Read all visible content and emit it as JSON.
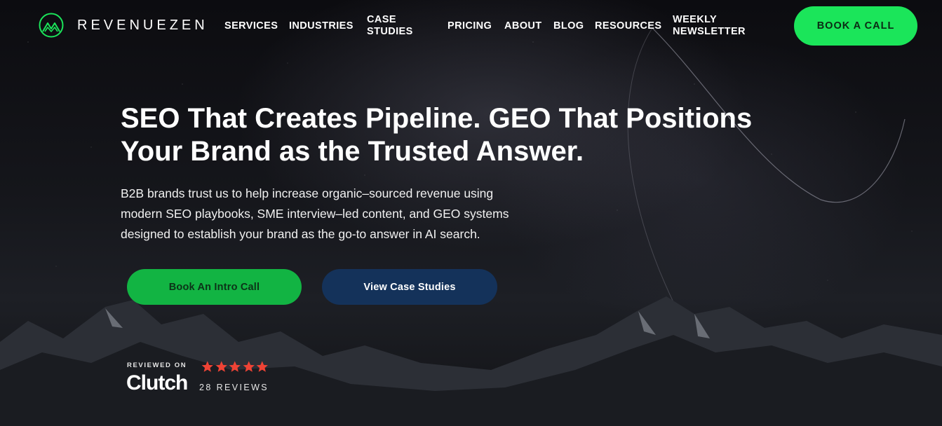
{
  "brand": {
    "name": "REVENUEZEN",
    "logo_icon": "mountain-logo-icon",
    "accent": "#1be55a"
  },
  "nav": [
    {
      "label": "SERVICES"
    },
    {
      "label": "INDUSTRIES"
    },
    {
      "label_line1": "CASE",
      "label_line2": "STUDIES"
    },
    {
      "label": "PRICING"
    },
    {
      "label": "ABOUT"
    },
    {
      "label": "BLOG"
    },
    {
      "label": "RESOURCES"
    },
    {
      "label_line1": "WEEKLY",
      "label_line2": "NEWSLETTER"
    }
  ],
  "header_cta": {
    "label": "BOOK A CALL",
    "color": "#1be55a"
  },
  "hero": {
    "headline_line1": "SEO That Creates Pipeline. GEO That Positions",
    "headline_line2": "Your Brand as the Trusted Answer.",
    "subtext_line1": "B2B brands trust us to help increase organic–sourced revenue using",
    "subtext_line2": "modern SEO playbooks, SME interview–led content, and GEO systems",
    "subtext_line3": "designed to establish your brand as the go-to answer in AI search.",
    "primary_button": {
      "label": "Book An Intro Call",
      "color": "#12b443"
    },
    "secondary_button": {
      "label": "View Case Studies",
      "color": "#14325a"
    }
  },
  "clutch": {
    "reviewed_on": "REVIEWED ON",
    "logo_text": "Clutch",
    "rating_stars": 5,
    "star_color": "#ef4335",
    "reviews": "28 REVIEWS"
  }
}
